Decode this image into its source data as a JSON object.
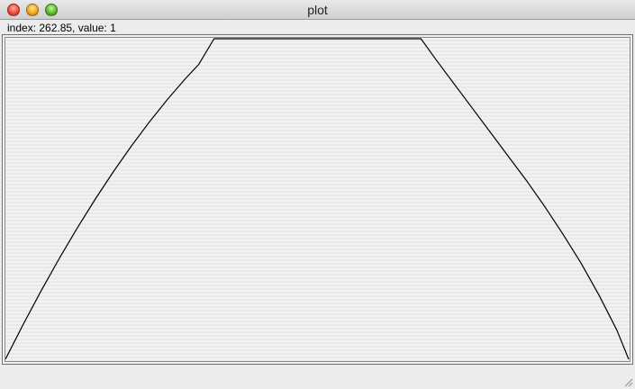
{
  "window": {
    "title": "plot"
  },
  "status": {
    "readout": "index: 262.85, value: 1"
  },
  "chart_data": {
    "type": "line",
    "title": "",
    "xlabel": "",
    "ylabel": "",
    "xlim": [
      0,
      693
    ],
    "ylim": [
      0,
      1
    ],
    "grid": false,
    "series": [
      {
        "x": [
          0,
          20,
          40,
          60,
          80,
          100,
          120,
          140,
          160,
          180,
          200,
          215,
          232,
          300,
          400,
          462,
          480,
          500,
          520,
          540,
          560,
          580,
          600,
          620,
          640,
          660,
          680,
          693
        ],
        "values": [
          0,
          0.11,
          0.215,
          0.315,
          0.41,
          0.5,
          0.585,
          0.665,
          0.74,
          0.81,
          0.875,
          0.92,
          1,
          1,
          1,
          1,
          0.93,
          0.855,
          0.78,
          0.705,
          0.63,
          0.555,
          0.475,
          0.39,
          0.3,
          0.2,
          0.09,
          0
        ]
      }
    ],
    "line_color": "#000000"
  }
}
